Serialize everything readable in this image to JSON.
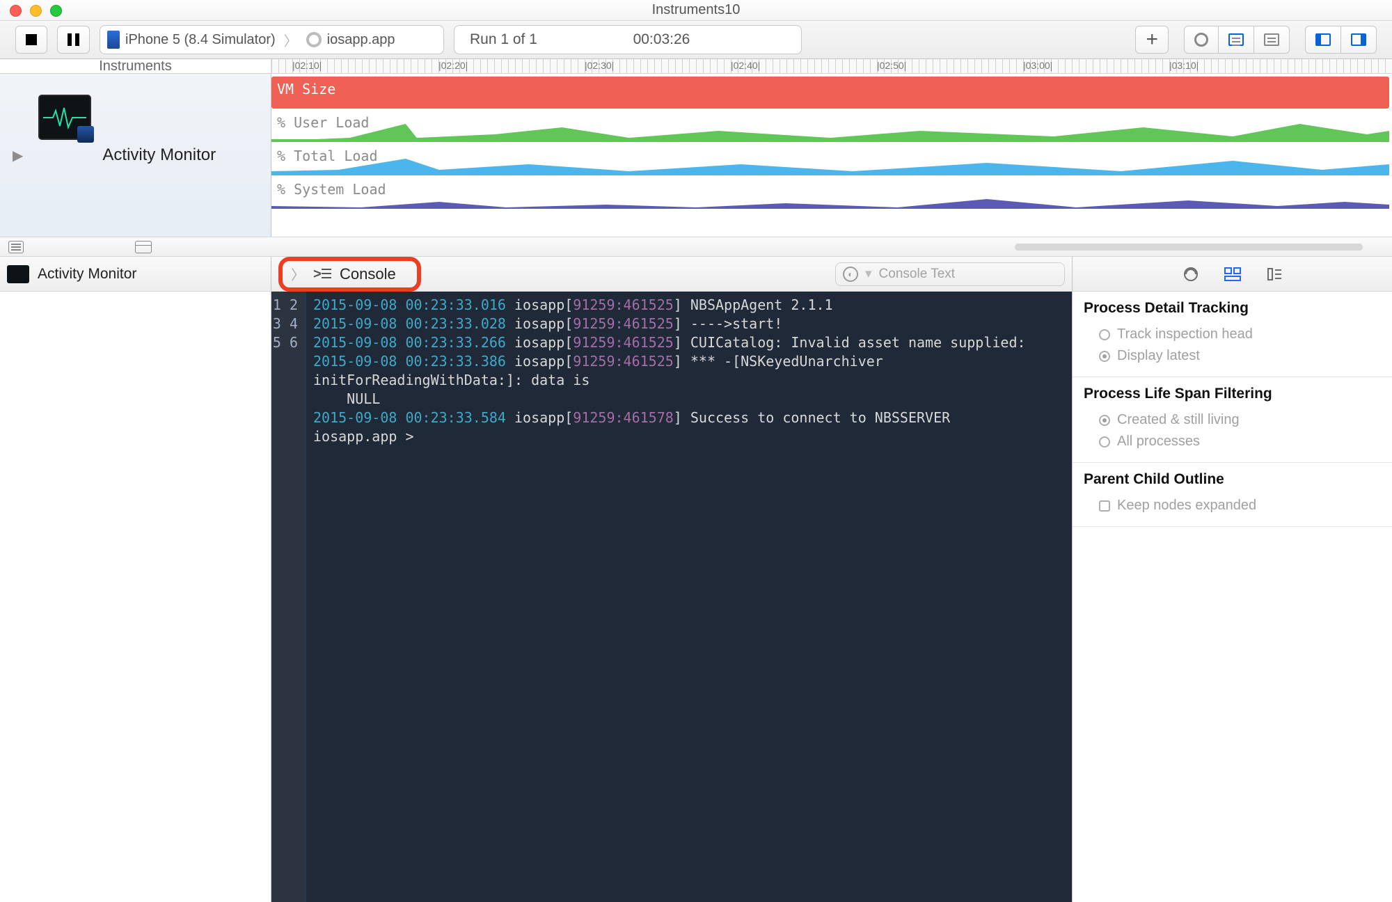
{
  "window": {
    "title": "Instruments10"
  },
  "toolbar": {
    "device": "iPhone 5 (8.4 Simulator)",
    "app": "iosapp.app",
    "run_label": "Run 1 of 1",
    "elapsed": "00:03:26"
  },
  "ruler": {
    "label": "Instruments",
    "ticks": [
      "02:10",
      "02:20",
      "02:30",
      "02:40",
      "02:50",
      "03:00",
      "03:10"
    ]
  },
  "trackSidebar": {
    "name": "Activity Monitor"
  },
  "tracks": {
    "vm": "VM Size",
    "user": "% User Load",
    "total": "% Total Load",
    "system": "% System Load"
  },
  "detailHeader": "Activity Monitor",
  "consoleTab": "Console",
  "consoleSearchPlaceholder": "Console Text",
  "consoleLines": [
    {
      "n": "1",
      "ts": "2015-09-08 00:23:33.016",
      "proc": "iosapp",
      "ids": "91259:461525",
      "msg": "NBSAppAgent 2.1.1"
    },
    {
      "n": "2",
      "ts": "2015-09-08 00:23:33.028",
      "proc": "iosapp",
      "ids": "91259:461525",
      "msg": "---->start!"
    },
    {
      "n": "3",
      "ts": "2015-09-08 00:23:33.266",
      "proc": "iosapp",
      "ids": "91259:461525",
      "msg": "CUICatalog: Invalid asset name supplied:"
    },
    {
      "n": "4",
      "ts": "2015-09-08 00:23:33.386",
      "proc": "iosapp",
      "ids": "91259:461525",
      "msg": "*** -[NSKeyedUnarchiver initForReadingWithData:]: data is",
      "extra": "NULL"
    },
    {
      "n": "5",
      "ts": "2015-09-08 00:23:33.584",
      "proc": "iosapp",
      "ids": "91259:461578",
      "msg": "Success to connect to NBSSERVER"
    },
    {
      "n": "6",
      "plain": "iosapp.app >"
    }
  ],
  "inspector": {
    "s1": {
      "title": "Process Detail Tracking",
      "opts": [
        "Track inspection head",
        "Display latest"
      ],
      "selIndex": 1
    },
    "s2": {
      "title": "Process Life Span Filtering",
      "opts": [
        "Created & still living",
        "All processes"
      ],
      "selIndex": 0
    },
    "s3": {
      "title": "Parent Child Outline",
      "chk": "Keep nodes expanded"
    }
  }
}
